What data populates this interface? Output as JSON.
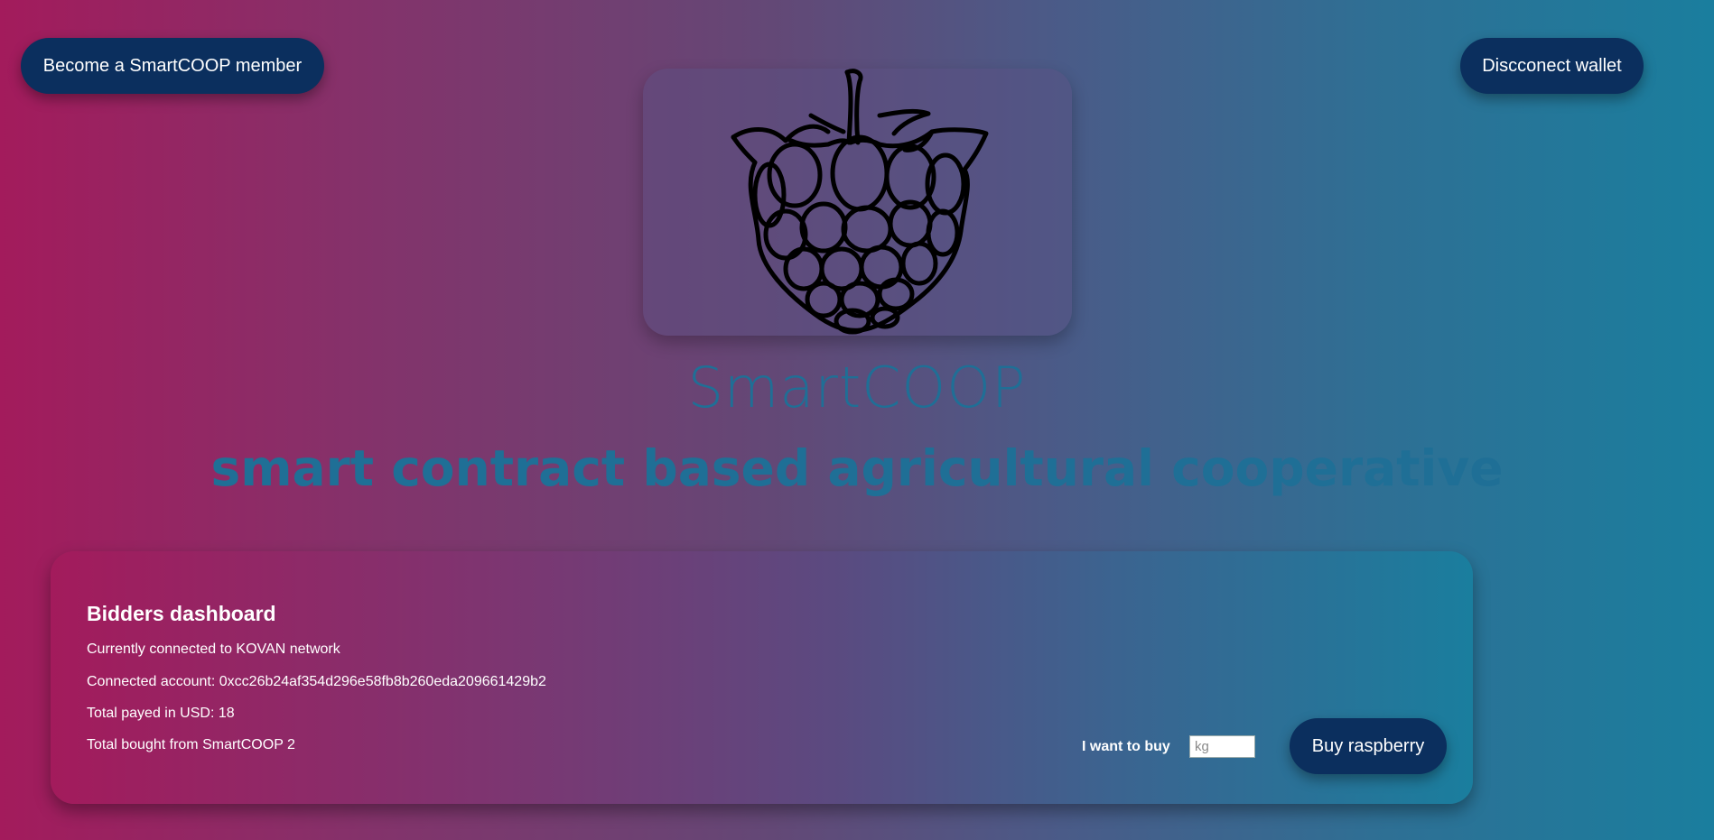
{
  "header": {
    "member_button": "Become a SmartCOOP member",
    "disconnect_button": "Discconect wallet"
  },
  "hero": {
    "logo_icon": "raspberry-icon",
    "title": "SmartCOOP",
    "subtitle": "smart contract based agricultural cooperative"
  },
  "dashboard": {
    "title": "Bidders dashboard",
    "network_line": "Currently connected to KOVAN network",
    "account_line": "Connected account: 0xcc26b24af354d296e58fb8b260eda209661429b2",
    "payed_line": "Total payed in USD: 18",
    "bought_line": "Total bought from SmartCOOP 2",
    "buy_label": "I want to buy",
    "kg_input_value": "",
    "kg_placeholder": "kg",
    "buy_button": "Buy raspberry"
  },
  "colors": {
    "button_bg": "#0b2f5e",
    "title_color": "#1f6f96",
    "gradient_left": "#a31b5c",
    "gradient_right": "#1a7e9e"
  }
}
